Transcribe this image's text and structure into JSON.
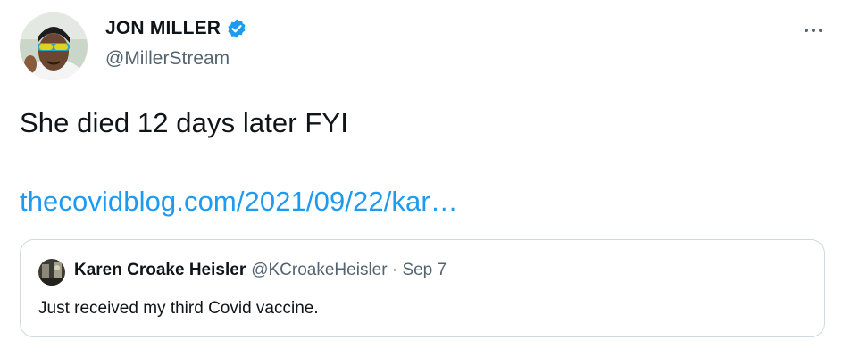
{
  "author": {
    "display_name": "JON MILLER",
    "handle": "@MillerStream",
    "avatar": "avatar-photo",
    "verified_icon": "verified-badge-icon",
    "verified_color": "#1d9bf0"
  },
  "more_icon": "more-options-icon",
  "tweet": {
    "text": "She died 12 days later FYI",
    "link": "thecovidblog.com/2021/09/22/kar…",
    "link_color": "#1d9bf0"
  },
  "quoted_tweet": {
    "display_name": "Karen Croake Heisler",
    "meta": "@KCroakeHeisler · Sep 7",
    "text": "Just received my third Covid vaccine.",
    "avatar": "quoted-avatar-photo"
  },
  "colors": {
    "text_primary": "#0f1419",
    "text_secondary": "#536471",
    "border": "#cfd9de"
  }
}
